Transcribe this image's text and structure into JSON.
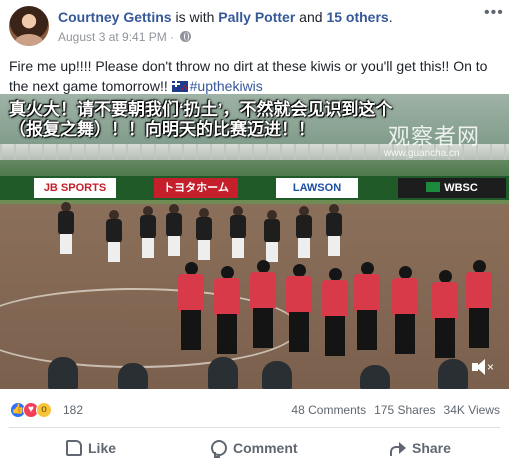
{
  "post": {
    "author": "Courtney Gettins",
    "with_text": " is with ",
    "tagged": "Pally Potter",
    "and_text": " and ",
    "others": "15 others",
    "period": ".",
    "timestamp": "August 3 at 9:41 PM",
    "separator": "·",
    "privacy_icon": "globe-icon",
    "more_icon": "ellipsis-icon",
    "text": "Fire me up!!!! Please don't throw no dirt at these kiwis or you'll get this!! On to the next game tomorrow!! ",
    "flag_icon": "new-zealand-flag-icon",
    "hashtag": "#upthekiwis"
  },
  "video": {
    "caption_line1": "真火大！请不要朝我们‘扔土’，不然就会见识到这个",
    "caption_line2": "（报复之舞）！！向明天的比赛迈进！！",
    "watermark_cn": "观察者网",
    "watermark_url": "www.guancha.cn",
    "banners": {
      "b1": "JB SPORTS",
      "b2": "トヨタホーム",
      "b3": "LAWSON",
      "b4": "WBSC"
    },
    "volume_icon": "volume-muted-icon",
    "colors": {
      "front_team": "#d93a4a",
      "back_team": "#1e1e1e"
    }
  },
  "stats": {
    "reaction_icons": [
      "like-icon",
      "love-icon",
      "wow-icon"
    ],
    "reaction_count": "182",
    "comments": "48 Comments",
    "shares": "175 Shares",
    "views": "34K Views"
  },
  "actions": {
    "like": "Like",
    "comment": "Comment",
    "share": "Share"
  },
  "theme": {
    "link_color": "#365899",
    "meta_color": "#90949c",
    "action_color": "#606770"
  }
}
